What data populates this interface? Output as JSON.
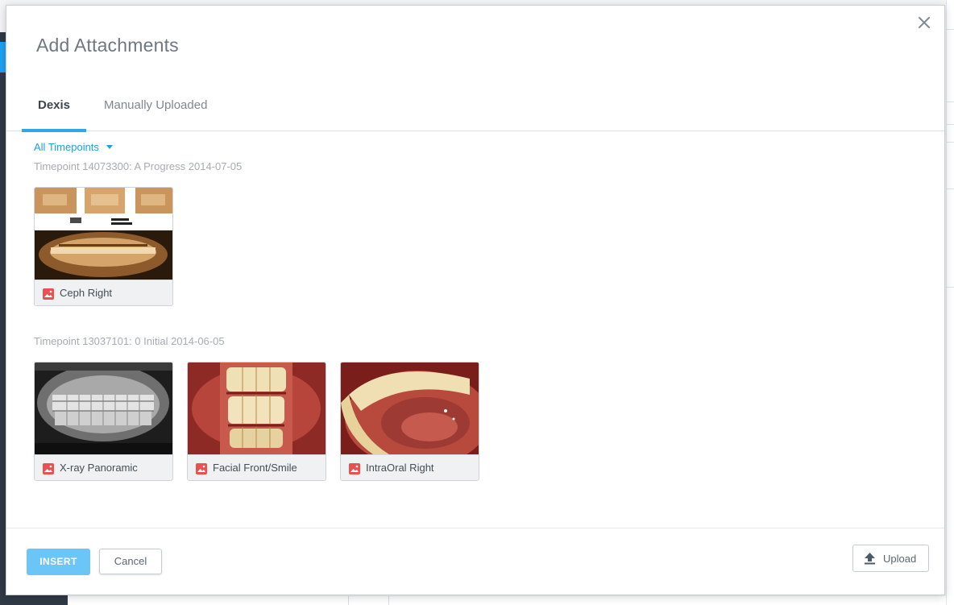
{
  "dialog": {
    "title": "Add Attachments",
    "close_icon": "close-icon"
  },
  "tabs": [
    {
      "label": "Dexis",
      "active": true
    },
    {
      "label": "Manually Uploaded",
      "active": false
    }
  ],
  "filter": {
    "label": "All Timepoints",
    "icon": "caret-down-icon"
  },
  "timepoints": [
    {
      "label": "Timepoint 14073300: A Progress 2014-07-05",
      "images": [
        {
          "caption": "Ceph Right",
          "icon": "image-icon"
        }
      ]
    },
    {
      "label": "Timepoint 13037101: 0 Initial 2014-06-05",
      "images": [
        {
          "caption": "X-ray Panoramic",
          "icon": "image-icon"
        },
        {
          "caption": "Facial Front/Smile",
          "icon": "image-icon"
        },
        {
          "caption": "IntraOral Right",
          "icon": "image-icon"
        }
      ]
    }
  ],
  "footer": {
    "insert_label": "INSERT",
    "cancel_label": "Cancel",
    "upload_label": "Upload",
    "upload_icon": "upload-icon"
  },
  "colors": {
    "accent": "#2ea7e8",
    "link": "#1e9fe1",
    "insert_button": "#6cc5f7",
    "image_icon": "#e9504f"
  }
}
